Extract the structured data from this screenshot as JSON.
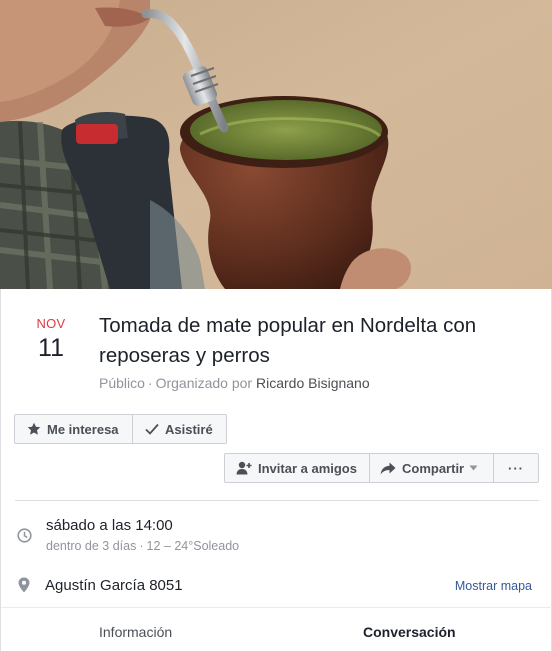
{
  "cover": {
    "alt": "Mate gourd with bombilla"
  },
  "event": {
    "month": "NOV",
    "day": "11",
    "title": "Tomada de mate popular en Nordelta con reposeras y perros",
    "privacy": "Público",
    "organized_by_label": "Organizado por",
    "organizer": "Ricardo Bisignano"
  },
  "actions": {
    "interested": "Me interesa",
    "attended": "Asistiré",
    "invite": "Invitar a amigos",
    "share": "Compartir",
    "more": "···"
  },
  "details": {
    "when": "sábado a las 14:00",
    "when_relative": "dentro de 3 días",
    "weather": "12 – 24°Soleado",
    "location": "Agustín García 8051",
    "show_map": "Mostrar mapa"
  },
  "tabs": [
    {
      "label": "Información",
      "active": false
    },
    {
      "label": "Conversación",
      "active": true
    }
  ],
  "icons": {
    "interested": "star-icon",
    "attended": "check-icon",
    "invite": "add-person-icon",
    "share": "share-arrow-icon",
    "share_menu": "caret-down-icon",
    "time": "clock-icon",
    "location": "map-pin-icon"
  },
  "colors": {
    "month": "#e0393e",
    "link": "#365899",
    "secondary_text": "#90949c",
    "button_bg": "#f6f7f9",
    "button_border": "#ccd0d5"
  }
}
